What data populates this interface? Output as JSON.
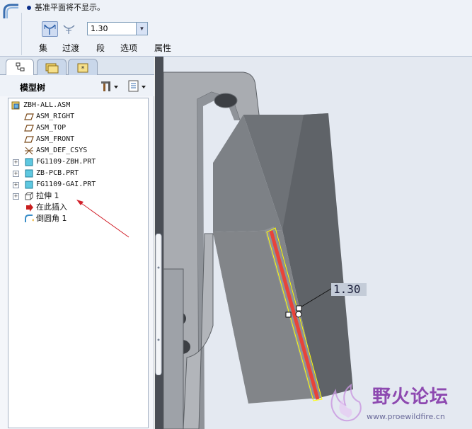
{
  "dashboard": {
    "message": "基准平面将不显示。",
    "radius_value": "1.30",
    "tabs": [
      {
        "label": "集"
      },
      {
        "label": "过渡"
      },
      {
        "label": "段"
      },
      {
        "label": "选项"
      },
      {
        "label": "属性"
      }
    ]
  },
  "navigator": {
    "title": "模型树",
    "tree": [
      {
        "label": "ZBH-ALL.ASM",
        "icon": "assembly-icon"
      },
      {
        "label": "ASM_RIGHT",
        "icon": "datum-plane-icon"
      },
      {
        "label": "ASM_TOP",
        "icon": "datum-plane-icon"
      },
      {
        "label": "ASM_FRONT",
        "icon": "datum-plane-icon"
      },
      {
        "label": "ASM_DEF_CSYS",
        "icon": "csys-icon"
      },
      {
        "label": "FG1109-ZBH.PRT",
        "icon": "part-icon"
      },
      {
        "label": "ZB-PCB.PRT",
        "icon": "part-icon"
      },
      {
        "label": "FG1109-GAI.PRT",
        "icon": "part-icon"
      },
      {
        "label": "拉伸 1",
        "icon": "extrude-icon"
      },
      {
        "label": "在此插入",
        "icon": "insert-here-icon"
      },
      {
        "label": "倒圆角 1",
        "icon": "round-icon"
      }
    ]
  },
  "graphics": {
    "dimension_label": "1.30"
  },
  "watermark": {
    "title": "野火论坛",
    "url": "www.proewildfire.cn"
  },
  "colors": {
    "selected_edge": "#e8443a",
    "highlight": "#ffff00",
    "model_surface": "#7a7e84",
    "annotation_arrow": "#d2202a"
  }
}
